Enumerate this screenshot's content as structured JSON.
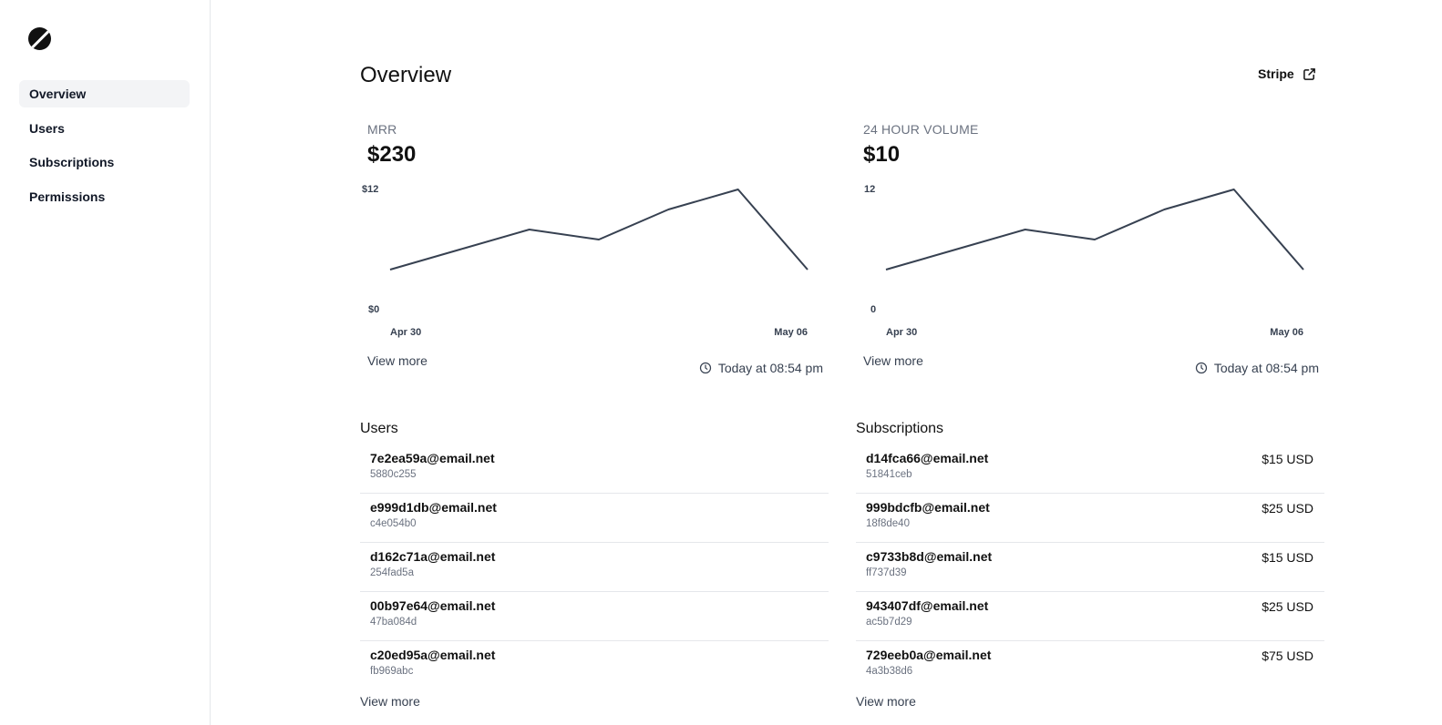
{
  "sidebar": {
    "items": [
      {
        "label": "Overview",
        "active": true
      },
      {
        "label": "Users",
        "active": false
      },
      {
        "label": "Subscriptions",
        "active": false
      },
      {
        "label": "Permissions",
        "active": false
      }
    ]
  },
  "header": {
    "title": "Overview",
    "stripe_label": "Stripe",
    "stripe_icon": "external-link-icon"
  },
  "cards": {
    "mrr": {
      "label": "MRR",
      "value": "$230",
      "view_more": "View more",
      "updated": "Today at 08:54 pm",
      "y_top_label": "$12",
      "y_bottom_label": "$0",
      "x_start_label": "Apr 30",
      "x_end_label": "May 06"
    },
    "volume": {
      "label": "24 HOUR VOLUME",
      "value": "$10",
      "view_more": "View more",
      "updated": "Today at 08:54 pm",
      "y_top_label": "12",
      "y_bottom_label": "0",
      "x_start_label": "Apr 30",
      "x_end_label": "May 06"
    }
  },
  "users": {
    "title": "Users",
    "view_more": "View more",
    "rows": [
      {
        "email": "7e2ea59a@email.net",
        "id": "5880c255"
      },
      {
        "email": "e999d1db@email.net",
        "id": "c4e054b0"
      },
      {
        "email": "d162c71a@email.net",
        "id": "254fad5a"
      },
      {
        "email": "00b97e64@email.net",
        "id": "47ba084d"
      },
      {
        "email": "c20ed95a@email.net",
        "id": "fb969abc"
      }
    ]
  },
  "subscriptions": {
    "title": "Subscriptions",
    "view_more": "View more",
    "rows": [
      {
        "email": "d14fca66@email.net",
        "id": "51841ceb",
        "amount": "$15 USD"
      },
      {
        "email": "999bdcfb@email.net",
        "id": "18f8de40",
        "amount": "$25 USD"
      },
      {
        "email": "c9733b8d@email.net",
        "id": "ff737d39",
        "amount": "$15 USD"
      },
      {
        "email": "943407df@email.net",
        "id": "ac5b7d29",
        "amount": "$25 USD"
      },
      {
        "email": "729eeb0a@email.net",
        "id": "4a3b38d6",
        "amount": "$75 USD"
      }
    ]
  },
  "chart_data": [
    {
      "type": "line",
      "title": "MRR",
      "x": [
        "Apr 30",
        "May 01",
        "May 02",
        "May 03",
        "May 04",
        "May 05",
        "May 06"
      ],
      "values": [
        4,
        6,
        8,
        7,
        10,
        12,
        4
      ],
      "ylim": [
        0,
        12
      ],
      "x_tick_labels": [
        "Apr 30",
        "May 06"
      ],
      "y_tick_labels": [
        "$0",
        "$12"
      ],
      "grid": false,
      "line_color": "#374151"
    },
    {
      "type": "line",
      "title": "24 HOUR VOLUME",
      "x": [
        "Apr 30",
        "May 01",
        "May 02",
        "May 03",
        "May 04",
        "May 05",
        "May 06"
      ],
      "values": [
        4,
        6,
        8,
        7,
        10,
        12,
        4
      ],
      "ylim": [
        0,
        12
      ],
      "x_tick_labels": [
        "Apr 30",
        "May 06"
      ],
      "y_tick_labels": [
        "0",
        "12"
      ],
      "grid": false,
      "line_color": "#374151"
    }
  ]
}
